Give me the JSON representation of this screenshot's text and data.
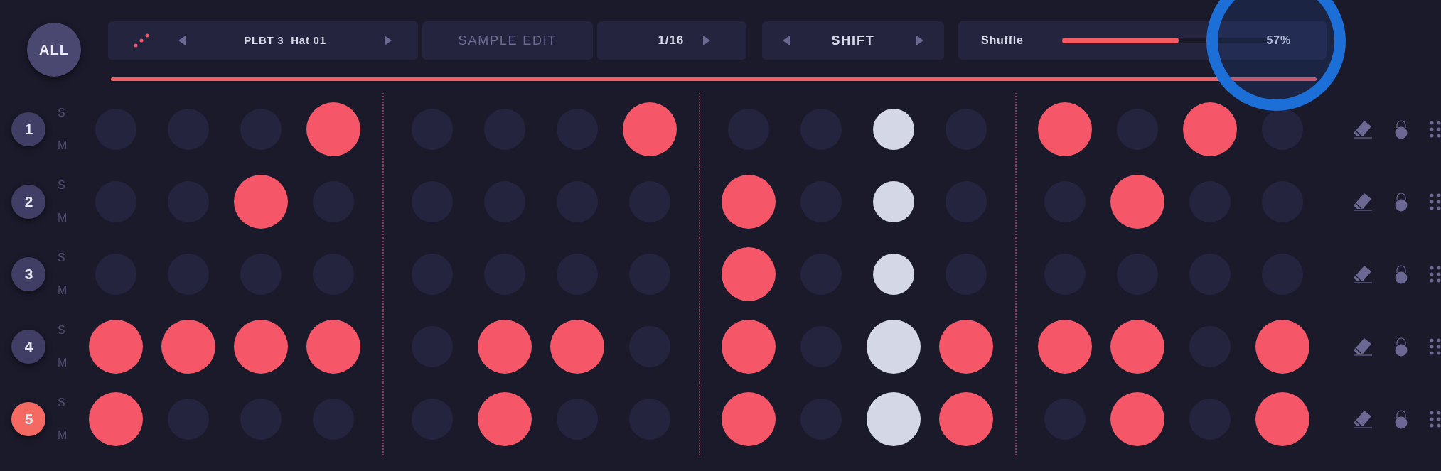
{
  "all_button": "ALL",
  "preset": {
    "name": "PLBT 3  Hat 01"
  },
  "sample_edit": "SAMPLE EDIT",
  "resolution": "1/16",
  "mode": "SHIFT",
  "shuffle": {
    "label": "Shuffle",
    "level": 0.57,
    "reading": "57%"
  },
  "step_columns": [
    {
      "current": false
    },
    {
      "current": false
    },
    {
      "current": false
    },
    {
      "current": false
    },
    {
      "current": false
    },
    {
      "current": false
    },
    {
      "current": false
    },
    {
      "current": false
    },
    {
      "current": false
    },
    {
      "current": false
    },
    {
      "current": true
    },
    {
      "current": false
    },
    {
      "current": false
    },
    {
      "current": false
    },
    {
      "current": false
    },
    {
      "current": false
    }
  ],
  "tracks": [
    {
      "label": "1",
      "solo": "S",
      "mute": "M",
      "selected": false,
      "steps": [
        false,
        false,
        false,
        true,
        false,
        false,
        false,
        true,
        false,
        false,
        false,
        false,
        true,
        false,
        true,
        false
      ]
    },
    {
      "label": "2",
      "solo": "S",
      "mute": "M",
      "selected": false,
      "steps": [
        false,
        false,
        true,
        false,
        false,
        false,
        false,
        false,
        true,
        false,
        false,
        false,
        false,
        true,
        false,
        false
      ]
    },
    {
      "label": "3",
      "solo": "S",
      "mute": "M",
      "selected": false,
      "steps": [
        false,
        false,
        false,
        false,
        false,
        false,
        false,
        false,
        true,
        false,
        false,
        false,
        false,
        false,
        false,
        false
      ]
    },
    {
      "label": "4",
      "solo": "S",
      "mute": "M",
      "selected": false,
      "steps": [
        true,
        true,
        true,
        true,
        false,
        true,
        true,
        false,
        true,
        false,
        true,
        true,
        true,
        true,
        false,
        true
      ]
    },
    {
      "label": "5",
      "solo": "S",
      "mute": "M",
      "selected": true,
      "steps": [
        true,
        false,
        false,
        false,
        false,
        true,
        false,
        false,
        true,
        false,
        true,
        true,
        false,
        true,
        false,
        true
      ]
    }
  ]
}
